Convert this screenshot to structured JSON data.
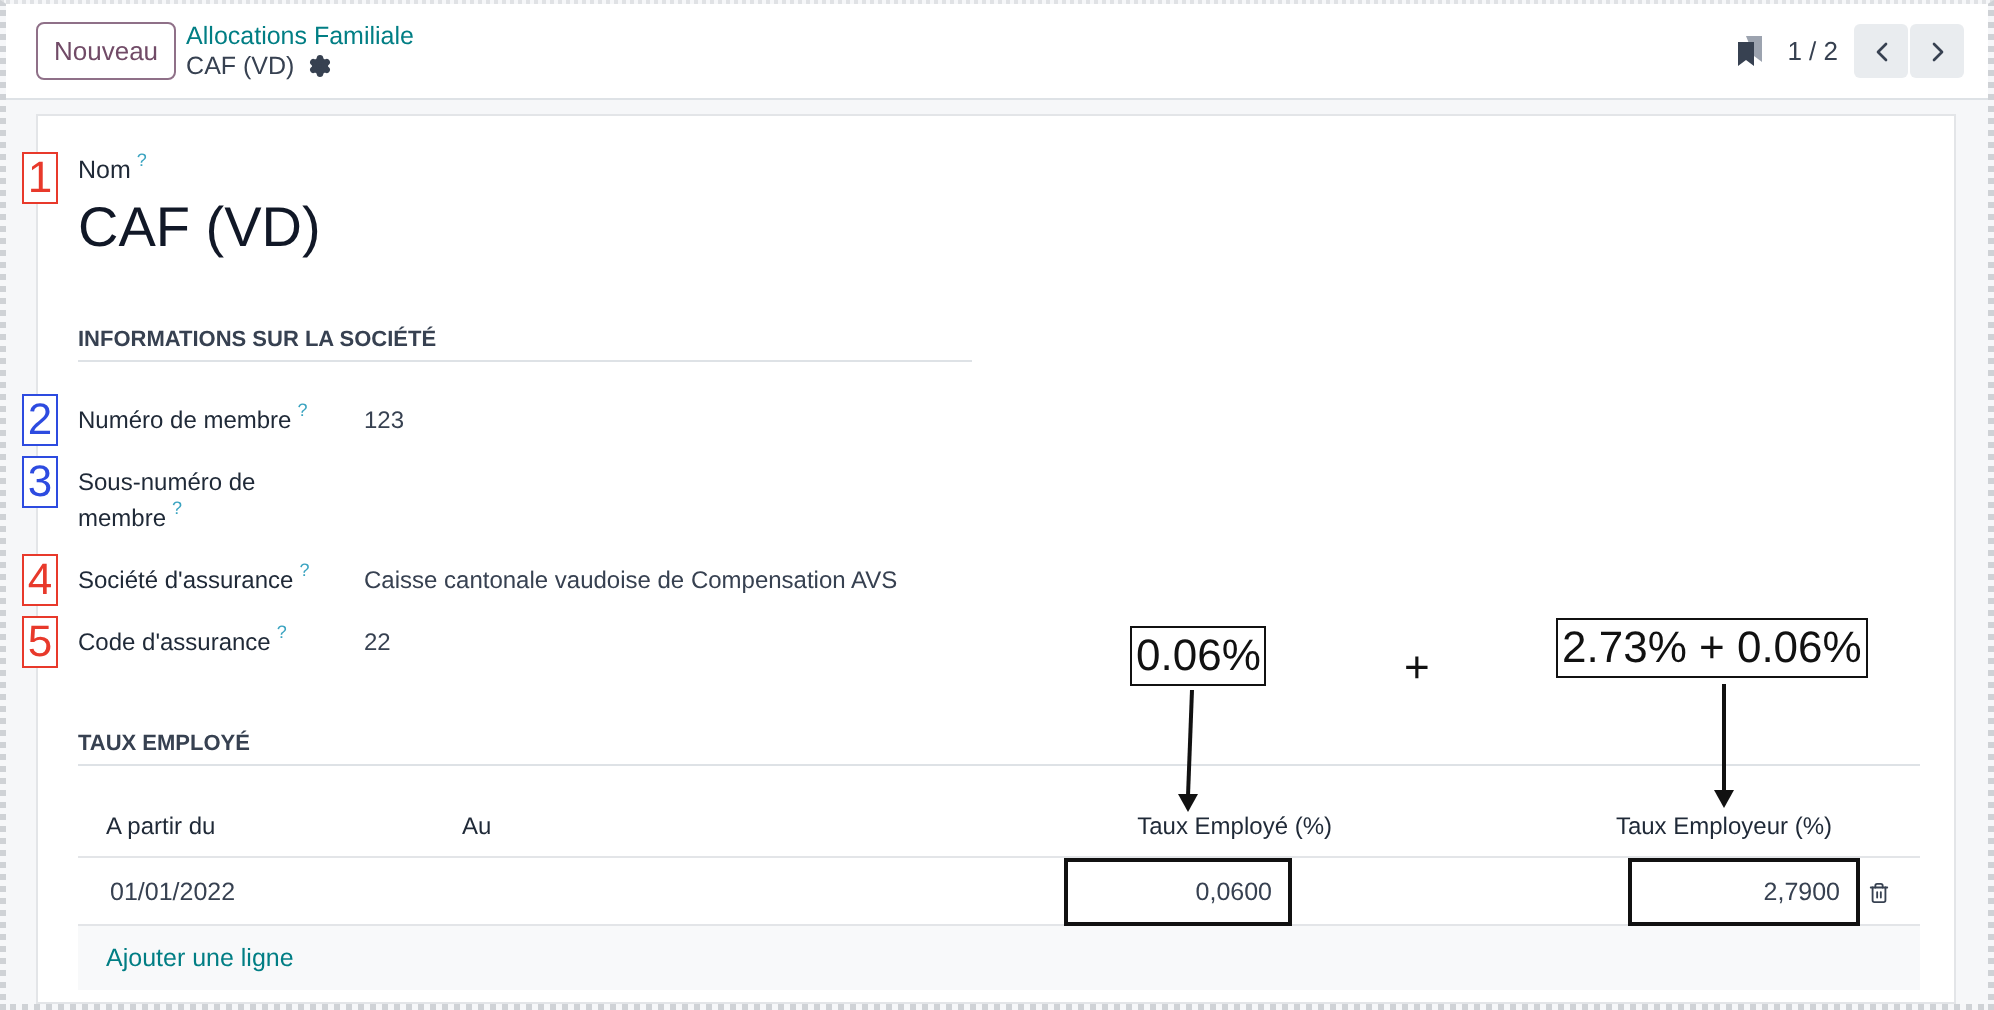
{
  "control_panel": {
    "new_button": "Nouveau",
    "breadcrumb": {
      "parent": "Allocations Familiale",
      "current": "CAF (VD)"
    },
    "pager": "1 / 2"
  },
  "form": {
    "name_label": "Nom",
    "name_help": "?",
    "name": "CAF (VD)",
    "name_marker": {
      "number": "1",
      "color": "#e8392b"
    },
    "company_section": {
      "title": "INFORMATIONS SUR LA SOCIÉTÉ",
      "fields": [
        {
          "label": "Numéro de membre",
          "help": "?",
          "value": "123",
          "marker": {
            "number": "2",
            "color": "#2d4be0"
          }
        },
        {
          "label": "Sous-numéro de membre",
          "help": "?",
          "marker": {
            "number": "3",
            "color": "#2d4be0"
          }
        },
        {
          "label": "Société d'assurance",
          "help": "?",
          "value": "Caisse cantonale vaudoise de Compensation AVS",
          "marker": {
            "number": "4",
            "color": "#e8392b"
          }
        },
        {
          "label": "Code d'assurance",
          "help": "?",
          "value": "22",
          "marker": {
            "number": "5",
            "color": "#e8392b"
          }
        }
      ]
    },
    "rates_section": {
      "title": "TAUX EMPLOYÉ",
      "columns": [
        "A partir du",
        "Au",
        "Taux Employé (%)",
        "Taux Employeur (%)"
      ],
      "rows": [
        {
          "from": {
            "text": "01/01/2022",
            "outlined": false
          },
          "employee_rate": {
            "text": "0,0600",
            "outlined": true
          },
          "employer_rate": {
            "text": "2,7900",
            "outlined": true
          }
        }
      ],
      "add_line": "Ajouter une ligne",
      "callouts": [
        {
          "kind": "box",
          "text": "0.06%"
        },
        {
          "kind": "plain",
          "text": "+"
        },
        {
          "kind": "box",
          "text": "2.73% + 0.06%"
        }
      ]
    }
  }
}
